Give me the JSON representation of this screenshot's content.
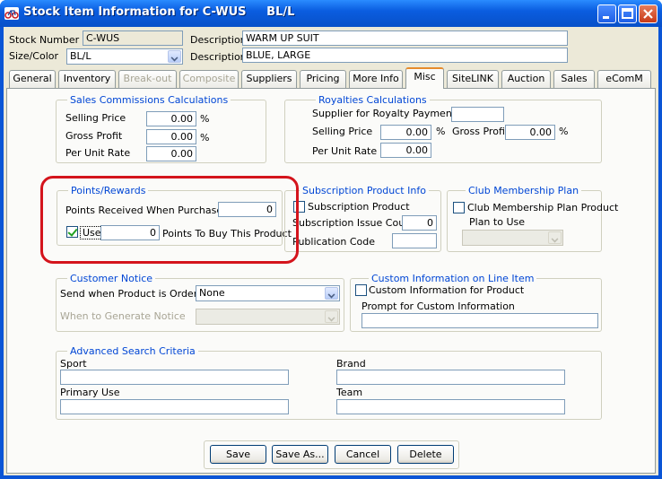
{
  "window": {
    "title": "Stock Item Information for C-WUS     BL/L"
  },
  "header": {
    "stock_number_label": "Stock Number",
    "stock_number_value": "C-WUS",
    "description_label": "Description",
    "description_value": "WARM UP SUIT",
    "size_color_label": "Size/Color",
    "size_color_value": "BL/L",
    "description2_label": "Description",
    "description2_value": "BLUE, LARGE"
  },
  "tabs": [
    {
      "label": "General",
      "state": "enabled"
    },
    {
      "label": "Inventory",
      "state": "enabled"
    },
    {
      "label": "Break-out",
      "state": "disabled"
    },
    {
      "label": "Composite",
      "state": "disabled"
    },
    {
      "label": "Suppliers",
      "state": "enabled"
    },
    {
      "label": "Pricing",
      "state": "enabled"
    },
    {
      "label": "More Info",
      "state": "enabled"
    },
    {
      "label": "Misc",
      "state": "active"
    },
    {
      "label": "SiteLINK",
      "state": "enabled"
    },
    {
      "label": "Auction",
      "state": "enabled"
    },
    {
      "label": "Sales",
      "state": "enabled"
    },
    {
      "label": "eComM",
      "state": "enabled"
    }
  ],
  "sales_commissions": {
    "title": "Sales Commissions Calculations",
    "selling_price_label": "Selling Price",
    "selling_price_value": "0.00",
    "gross_profit_label": "Gross Profit",
    "gross_profit_value": "0.00",
    "per_unit_rate_label": "Per Unit Rate",
    "per_unit_rate_value": "0.00",
    "percent_sign": "%"
  },
  "royalties": {
    "title": "Royalties Calculations",
    "supplier_label": "Supplier for Royalty Payment",
    "supplier_value": "",
    "selling_price_label": "Selling Price",
    "selling_price_value": "0.00",
    "gross_profit_label": "Gross Profit",
    "gross_profit_value": "0.00",
    "per_unit_rate_label": "Per Unit Rate $",
    "per_unit_rate_value": "0.00",
    "percent_sign": "%"
  },
  "points_rewards": {
    "title": "Points/Rewards",
    "received_label": "Points Received When Purchased",
    "received_value": "0",
    "use_label": "Use",
    "use_checked": true,
    "use_value": "0",
    "buy_label": "Points To Buy This Product"
  },
  "subscription": {
    "title": "Subscription Product Info",
    "product_label": "Subscription Product",
    "issue_count_label": "Subscription Issue Count",
    "issue_count_value": "0",
    "publication_code_label": "Publication Code",
    "publication_code_value": ""
  },
  "club": {
    "title": "Club Membership Plan",
    "product_label": "Club Membership Plan Product",
    "plan_label": "Plan to Use",
    "plan_value": ""
  },
  "customer_notice": {
    "title": "Customer Notice",
    "send_label": "Send when Product is Ordered",
    "send_value": "None",
    "when_label": "When to Generate Notice",
    "when_value": ""
  },
  "custom_info": {
    "title": "Custom Information on Line Item",
    "product_label": "Custom Information for Product",
    "prompt_label": "Prompt for Custom Information",
    "prompt_value": ""
  },
  "advanced_search": {
    "title": "Advanced Search Criteria",
    "sport_label": "Sport",
    "sport_value": "",
    "brand_label": "Brand",
    "brand_value": "",
    "primary_use_label": "Primary Use",
    "primary_use_value": "",
    "team_label": "Team",
    "team_value": ""
  },
  "buttons": {
    "save": "Save",
    "save_as": "Save As...",
    "cancel": "Cancel",
    "delete": "Delete"
  },
  "colors": {
    "title_bar": "#0a5de0",
    "highlight": "#d4141c",
    "group_title": "#0046d5",
    "active_tab_accent": "#e68b2c"
  }
}
